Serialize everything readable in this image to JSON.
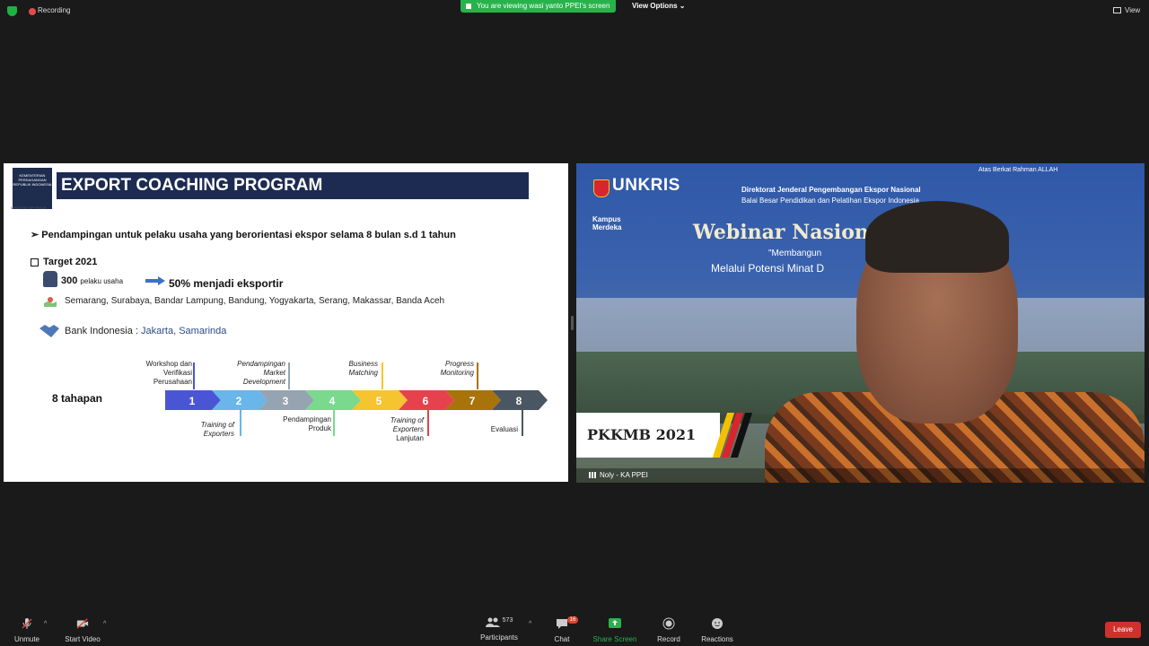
{
  "topbar": {
    "recording": "Recording",
    "share_banner": "You are viewing wasi yanto PPEI's screen",
    "view_options": "View Options",
    "view": "View"
  },
  "slide": {
    "logo_text": "KEMENTERIAN PERDAGANGAN REPUBLIK INDONESIA",
    "logo_sub": "MINISTRY OF TRADE",
    "title": "EXPORT COACHING PROGRAM",
    "bullet1": "Pendampingan untuk pelaku usaha yang berorientasi ekspor selama 8 bulan s.d 1 tahun",
    "bullet2": "Target 2021",
    "target_count": "300",
    "target_unit": "pelaku usaha",
    "target_pct": "50% menjadi eksportir",
    "cities": "Semarang, Surabaya, Bandar Lampung, Bandung, Yogyakarta, Serang, Makassar, Banda Aceh",
    "bank_label": "Bank Indonesia : ",
    "bank_places": "Jakarta, Samarinda",
    "tahapan": "8 tahapan",
    "steps": [
      {
        "num": "1",
        "color": "#4a55d6"
      },
      {
        "num": "2",
        "color": "#68b6ea"
      },
      {
        "num": "3",
        "color": "#96a3b1"
      },
      {
        "num": "4",
        "color": "#79d98c"
      },
      {
        "num": "5",
        "color": "#f6c331"
      },
      {
        "num": "6",
        "color": "#e5424d"
      },
      {
        "num": "7",
        "color": "#a8730a"
      },
      {
        "num": "8",
        "color": "#4a5661"
      }
    ],
    "labels": {
      "s1": "Workshop dan\nVerifikasi\nPerusahaan",
      "s2": "Training of\nExporters",
      "s3": "Pendampingan\nMarket\nDevelopment",
      "s4": "Pendampingan\nProduk",
      "s5": "Business\nMatching",
      "s6a": "Training of\nExporters",
      "s6b": "Lanjutan",
      "s7": "Progress\nMonitoring",
      "s8": "Evaluasi"
    }
  },
  "video": {
    "unkris": "UNKRIS",
    "dirjen": "Direktorat Jenderal Pengembangan Ekspor Nasional",
    "balai": "Balai Besar Pendidikan dan Pelatihan Ekspor Indonesia",
    "atas": "Atas Berkat Rahman ALLAH",
    "kampus": "Kampus Merdeka",
    "webinar": "Webinar Nasional",
    "membangun": "\"Membangun",
    "melalui": "Melalui Potensi Minat D",
    "pkkmb": "PKKMB 2021",
    "name": "Noly - KA PPEI"
  },
  "toolbar": {
    "unmute": "Unmute",
    "start_video": "Start Video",
    "participants": "Participants",
    "participants_count": "573",
    "chat": "Chat",
    "chat_badge": "16",
    "share_screen": "Share Screen",
    "record": "Record",
    "reactions": "Reactions",
    "leave": "Leave"
  }
}
